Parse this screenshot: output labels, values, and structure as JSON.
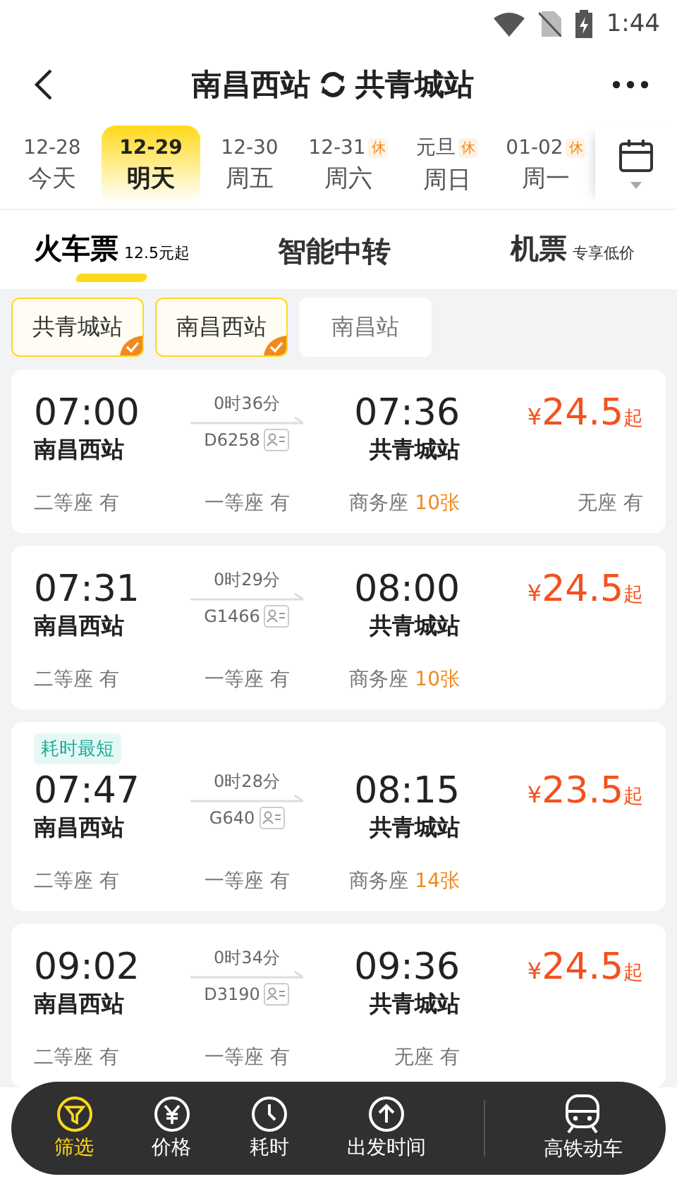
{
  "status_bar": {
    "time": "1:44"
  },
  "header": {
    "from": "南昌西站",
    "to": "共青城站"
  },
  "dates": [
    {
      "date": "12-28",
      "day": "今天",
      "selected": false
    },
    {
      "date": "12-29",
      "day": "明天",
      "selected": true
    },
    {
      "date": "12-30",
      "day": "周五",
      "selected": false
    },
    {
      "date": "12-31",
      "holiday": "休",
      "day": "周六",
      "selected": false
    },
    {
      "date": "元旦",
      "holiday": "休",
      "day": "周日",
      "selected": false
    },
    {
      "date": "01-02",
      "holiday": "休",
      "day": "周一",
      "selected": false
    }
  ],
  "tabs": [
    {
      "label": "火车票",
      "note": "12.5元起",
      "selected": true
    },
    {
      "label": "智能中转",
      "selected": false
    },
    {
      "label": "机票",
      "note": "专享低价",
      "selected": false
    }
  ],
  "stations": [
    {
      "label": "共青城站",
      "selected": true
    },
    {
      "label": "南昌西站",
      "selected": true
    },
    {
      "label": "南昌站",
      "selected": false
    }
  ],
  "trains": [
    {
      "dep_time": "07:00",
      "dep_station": "南昌西站",
      "duration": "0时36分",
      "train_no": "D6258",
      "arr_time": "07:36",
      "arr_station": "共青城站",
      "currency": "¥",
      "price": "24.5",
      "suffix": "起",
      "seats": [
        {
          "label": "二等座",
          "value": "有",
          "low": false
        },
        {
          "label": "一等座",
          "value": "有",
          "low": false
        },
        {
          "label": "商务座",
          "value": "10张",
          "low": true
        },
        {
          "label": "无座",
          "value": "有",
          "low": false
        }
      ]
    },
    {
      "dep_time": "07:31",
      "dep_station": "南昌西站",
      "duration": "0时29分",
      "train_no": "G1466",
      "arr_time": "08:00",
      "arr_station": "共青城站",
      "currency": "¥",
      "price": "24.5",
      "suffix": "起",
      "seats": [
        {
          "label": "二等座",
          "value": "有",
          "low": false
        },
        {
          "label": "一等座",
          "value": "有",
          "low": false
        },
        {
          "label": "商务座",
          "value": "10张",
          "low": true
        }
      ]
    },
    {
      "tag": "耗时最短",
      "dep_time": "07:47",
      "dep_station": "南昌西站",
      "duration": "0时28分",
      "train_no": "G640",
      "arr_time": "08:15",
      "arr_station": "共青城站",
      "currency": "¥",
      "price": "23.5",
      "suffix": "起",
      "seats": [
        {
          "label": "二等座",
          "value": "有",
          "low": false
        },
        {
          "label": "一等座",
          "value": "有",
          "low": false
        },
        {
          "label": "商务座",
          "value": "14张",
          "low": true
        }
      ]
    },
    {
      "dep_time": "09:02",
      "dep_station": "南昌西站",
      "duration": "0时34分",
      "train_no": "D3190",
      "arr_time": "09:36",
      "arr_station": "共青城站",
      "currency": "¥",
      "price": "24.5",
      "suffix": "起",
      "seats": [
        {
          "label": "二等座",
          "value": "有",
          "low": false
        },
        {
          "label": "一等座",
          "value": "有",
          "low": false
        },
        {
          "label": "无座",
          "value": "有",
          "low": false
        }
      ]
    }
  ],
  "bottom_bar": [
    {
      "kind": "filter",
      "label": "筛选",
      "selected": true
    },
    {
      "kind": "price",
      "label": "价格",
      "selected": false
    },
    {
      "kind": "duration",
      "label": "耗时",
      "selected": false
    },
    {
      "kind": "departure",
      "label": "出发时间",
      "selected": false
    },
    {
      "kind": "train",
      "label": "高铁动车",
      "selected": false
    }
  ]
}
